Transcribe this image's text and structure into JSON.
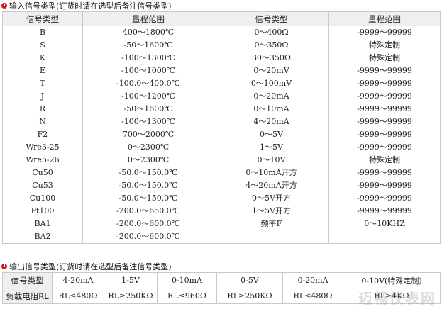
{
  "input_section": {
    "title": "输入信号类型(订货时请在选型后备注信号类型)",
    "headers": [
      "信号类型",
      "量程范围",
      "信号类型",
      "量程范围"
    ],
    "rows": [
      [
        "B",
        "400～1800℃",
        "0～400Ω",
        "-9999～99999"
      ],
      [
        "S",
        "-50～1600℃",
        "0～350Ω",
        "特殊定制"
      ],
      [
        "K",
        "-100～1300℃",
        "30～350Ω",
        "特殊定制"
      ],
      [
        "E",
        "-100～1000℃",
        "0～20mV",
        "-9999～99999"
      ],
      [
        "T",
        "-100.0～400.0℃",
        "0～100mV",
        "-9999～99999"
      ],
      [
        "J",
        "-100～1200℃",
        "0～20mA",
        "-9999～99999"
      ],
      [
        "R",
        "-50～1600℃",
        "0～10mA",
        "-9999～99999"
      ],
      [
        "N",
        "-100～1300℃",
        "4～20mA",
        "-9999～99999"
      ],
      [
        "F2",
        "700～2000℃",
        "0～5V",
        "-9999～99999"
      ],
      [
        "Wre3-25",
        "0～2300℃",
        "1～5V",
        "-9999～99999"
      ],
      [
        "Wre5-26",
        "0～2300℃",
        "0～10V",
        "特殊定制"
      ],
      [
        "Cu50",
        "-50.0～150.0℃",
        "0～10mA开方",
        "-9999～99999"
      ],
      [
        "Cu53",
        "-50.0～150.0℃",
        "4～20mA开方",
        "-9999～99999"
      ],
      [
        "Cu100",
        "-50.0～150.0℃",
        "0～5V开方",
        "-9999～99999"
      ],
      [
        "Pt100",
        "-200.0～650.0℃",
        "1～5V开方",
        "-9999～99999"
      ],
      [
        "BA1",
        "-200.0～600.0℃",
        "频率F",
        "0～10KHZ"
      ],
      [
        "BA2",
        "-200.0～600.0℃",
        "",
        ""
      ]
    ]
  },
  "output_section": {
    "title": "输出信号类型(订货时请在选型后备注信号类型)",
    "signal_label": "信号类型",
    "signals": [
      "4-20mA",
      "1-5V",
      "0-10mA",
      "0-5V",
      "0-20mA",
      "0-10V(特殊定制)"
    ],
    "load_label": "负载电阻RL",
    "loads": [
      "RL≤480Ω",
      "RL≥250KΩ",
      "RL≤960Ω",
      "RL≥250KΩ",
      "RL≤480Ω",
      "RL≥4KΩ"
    ]
  },
  "watermark": "迈畅仪表网",
  "colors": {
    "bullet": "#d8141b",
    "header_bg": "#efefef",
    "border": "#c9c9c9"
  }
}
